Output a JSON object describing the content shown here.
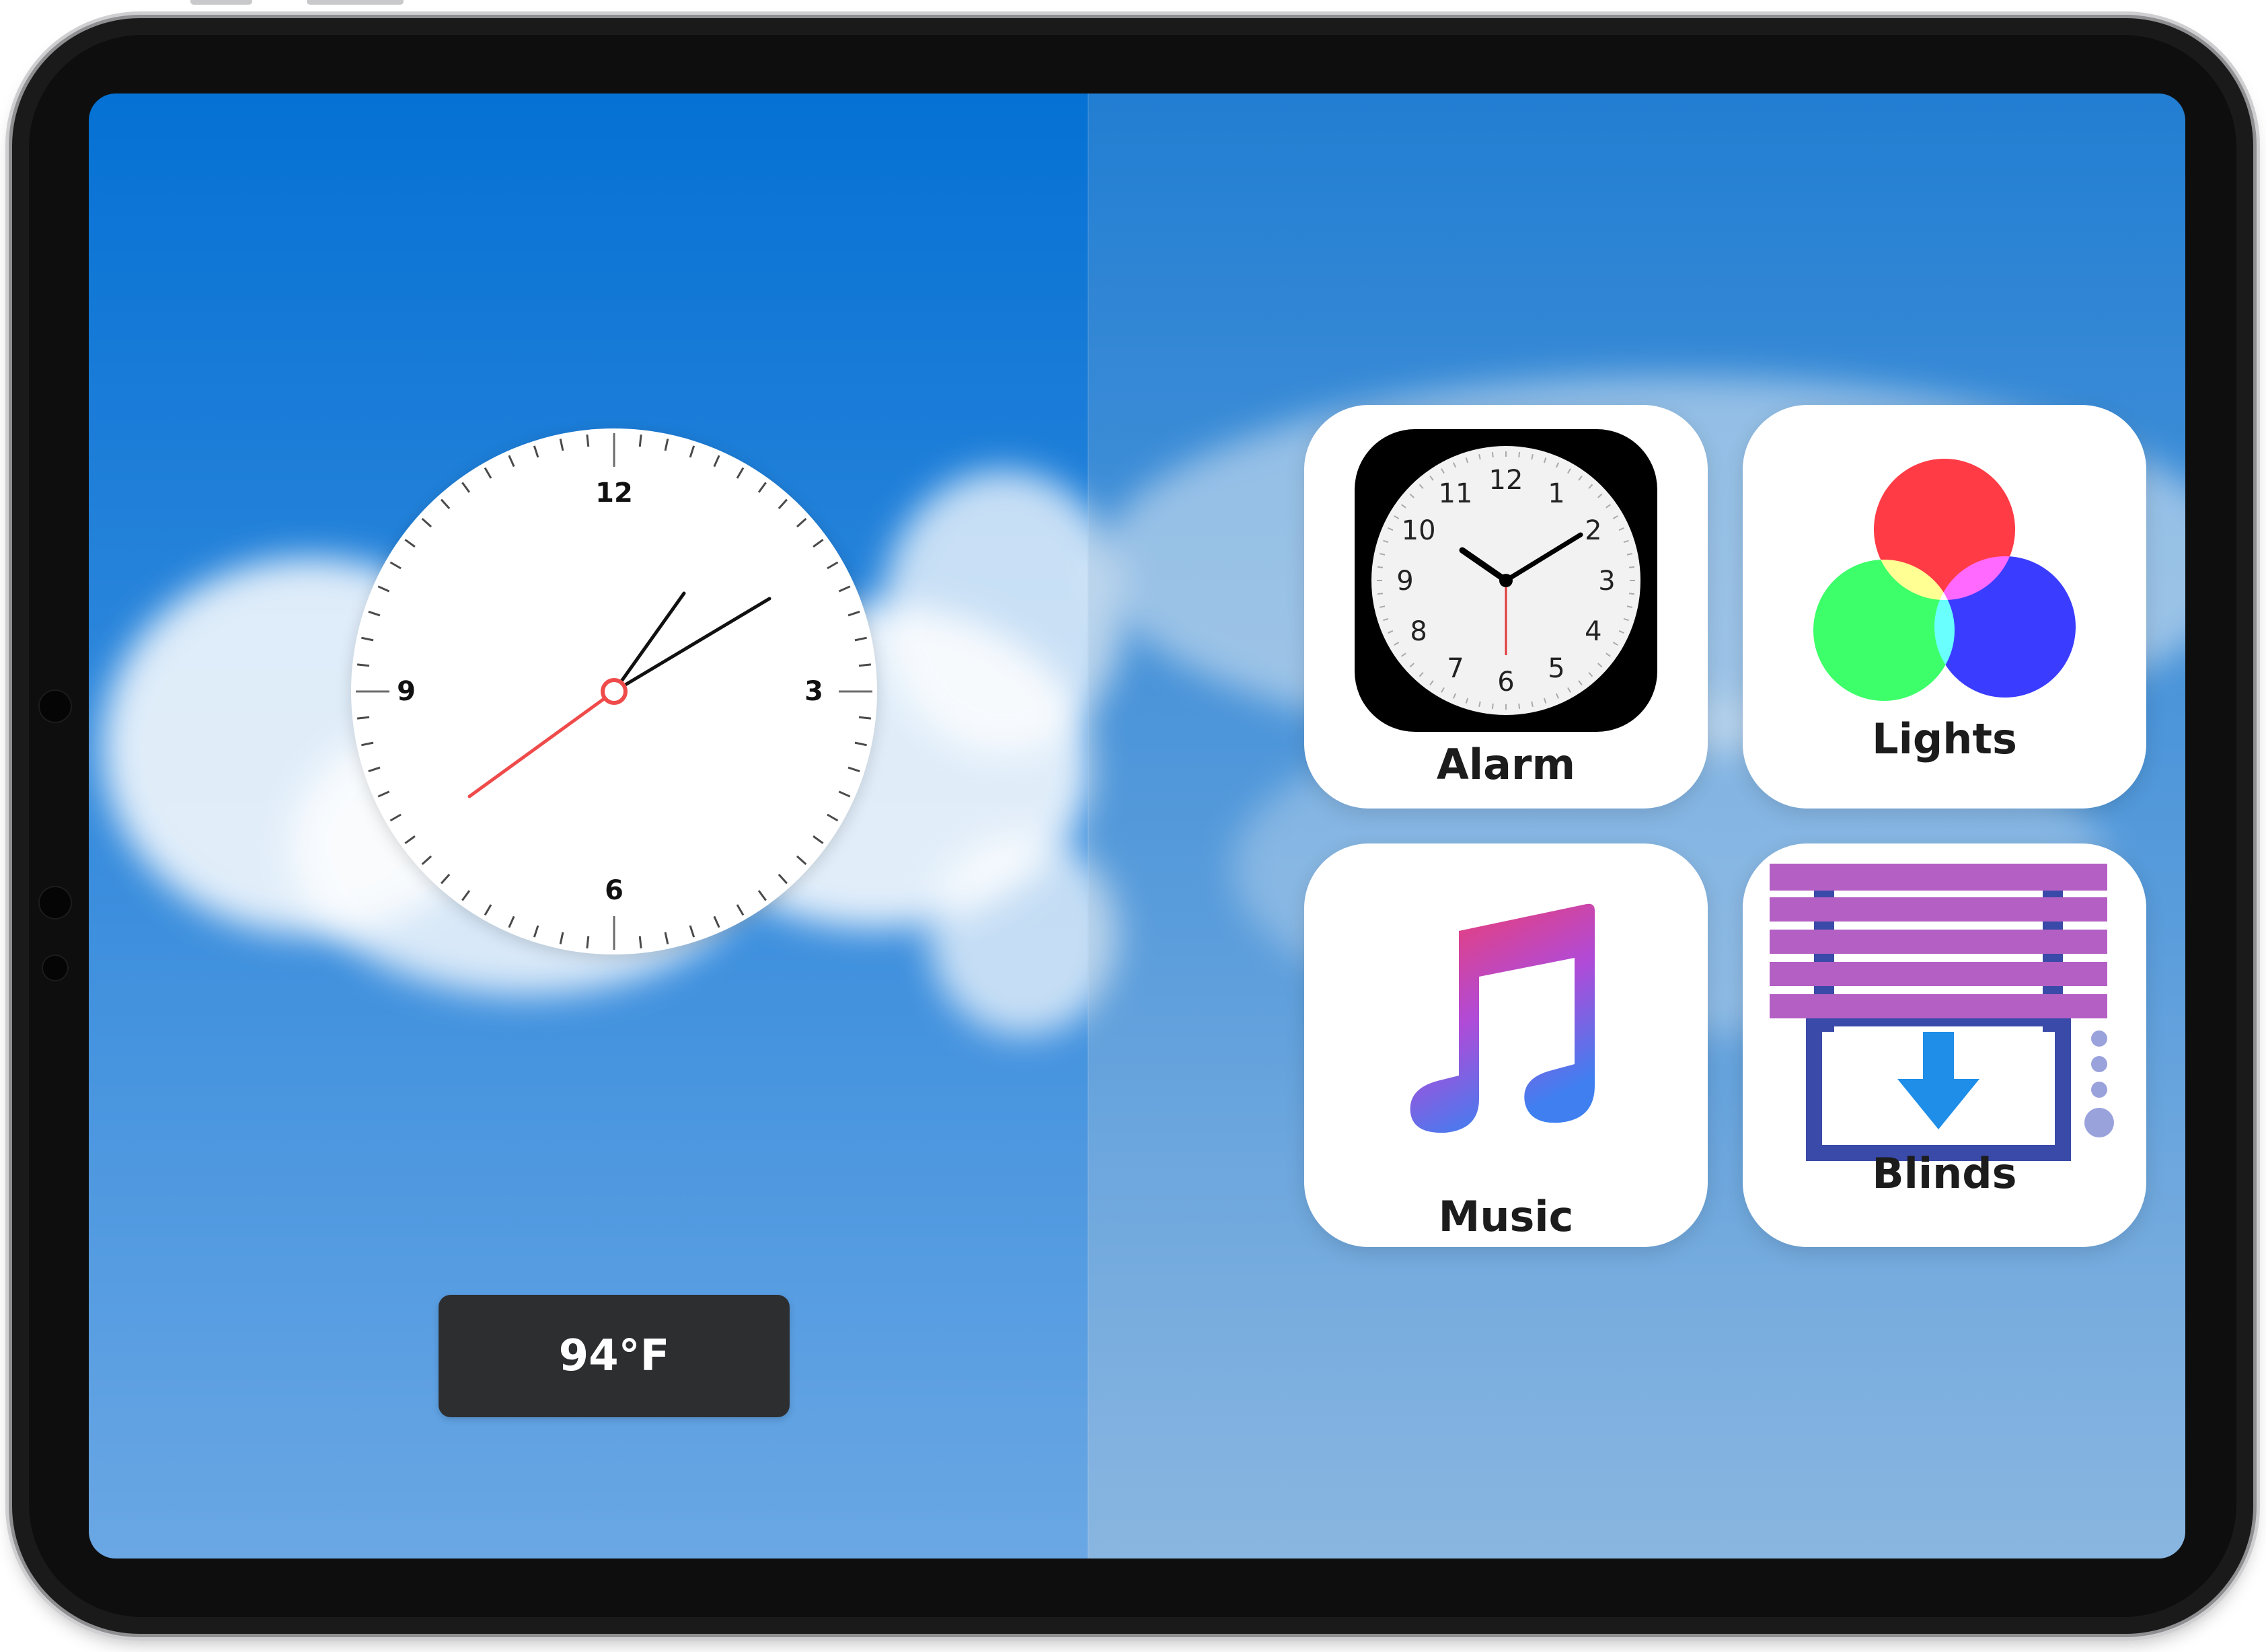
{
  "clock": {
    "numerals": {
      "twelve": "12",
      "three": "3",
      "six": "6",
      "nine": "9"
    },
    "second_hand_color": "#ef4b4b"
  },
  "temperature": {
    "value": "94°F"
  },
  "tiles": {
    "alarm": {
      "label": "Alarm",
      "icon": "clock-app-icon",
      "dial_numbers": [
        "12",
        "1",
        "2",
        "3",
        "4",
        "5",
        "6",
        "7",
        "8",
        "9",
        "10",
        "11"
      ]
    },
    "lights": {
      "label": "Lights",
      "icon": "rgb-color-circles-icon"
    },
    "music": {
      "label": "Music",
      "icon": "music-note-icon"
    },
    "blinds": {
      "label": "Blinds",
      "icon": "window-blinds-icon"
    }
  },
  "colors": {
    "sky_top": "#0571d4",
    "sky_bottom": "#6aa7e4",
    "temp_button_bg": "#2c2e30",
    "blinds_slat": "#b45fc4",
    "blinds_frame": "#3a4aa8",
    "blinds_arrow": "#1e8ee8"
  }
}
